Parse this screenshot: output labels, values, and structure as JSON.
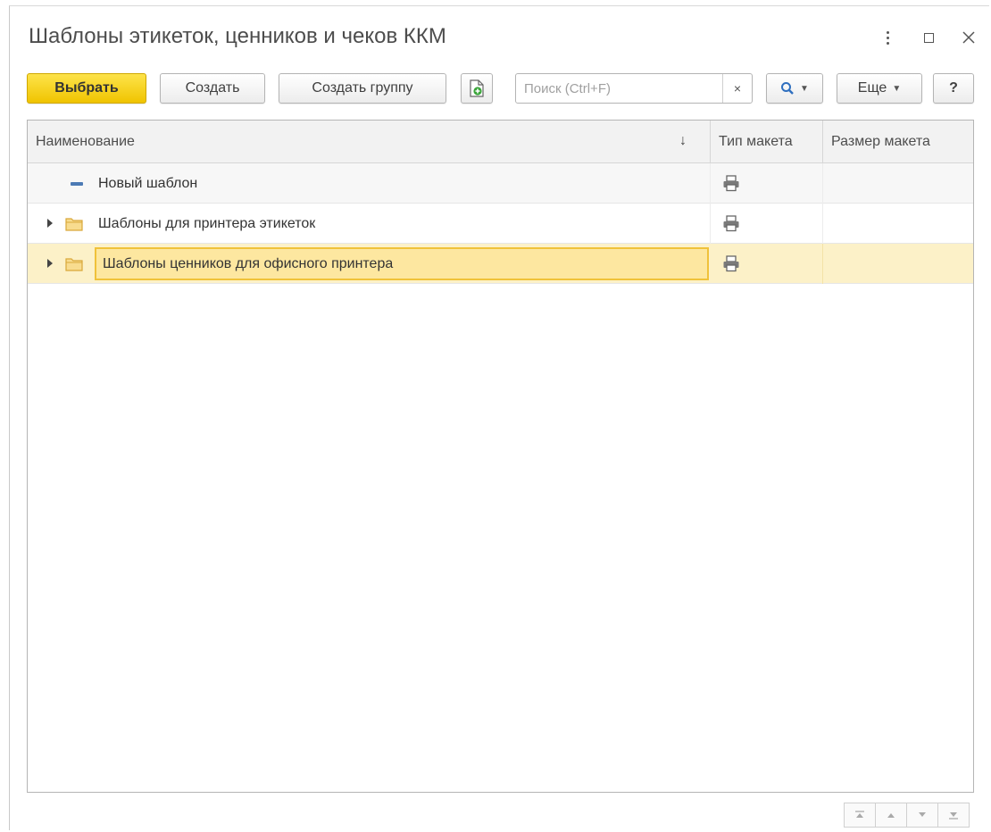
{
  "window": {
    "title": "Шаблоны этикеток, ценников и чеков ККМ"
  },
  "toolbar": {
    "select_label": "Выбрать",
    "create_label": "Создать",
    "create_group_label": "Создать группу",
    "search_placeholder": "Поиск (Ctrl+F)",
    "search_value": "",
    "clear_label": "×",
    "more_label": "Еще",
    "help_label": "?"
  },
  "table": {
    "columns": [
      "Наименование",
      "Тип макета",
      "Размер макета"
    ],
    "sort_indicator": "↓",
    "rows": [
      {
        "name": "Новый шаблон",
        "kind": "item",
        "icon": "item-dash-icon",
        "type_icon": "printer-icon",
        "size": ""
      },
      {
        "name": "Шаблоны для принтера этикеток",
        "kind": "group",
        "icon": "folder-icon",
        "type_icon": "printer-icon",
        "size": ""
      },
      {
        "name": "Шаблоны ценников для офисного принтера",
        "kind": "group",
        "icon": "folder-icon",
        "type_icon": "printer-icon",
        "size": "",
        "selected": true
      }
    ]
  },
  "colors": {
    "primary_button": "#f5cf1e",
    "selected_row": "#fcf1c8",
    "folder": "#f5c95a",
    "item_icon": "#4c7ab5"
  }
}
